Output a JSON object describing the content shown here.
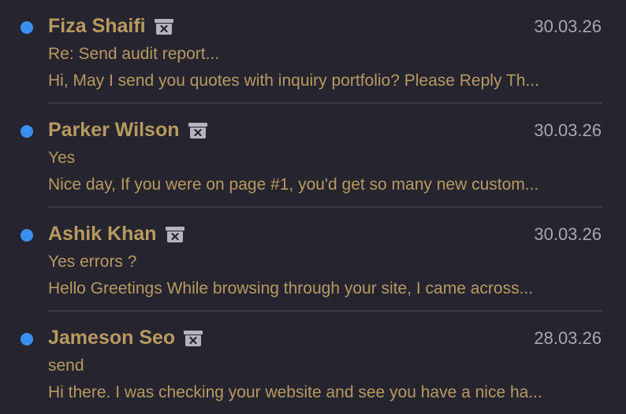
{
  "colors": {
    "background": "#25242f",
    "unread_dot": "#3b8ff2",
    "text_gold": "#b89a61",
    "date_gray": "#a8a6b1",
    "divider": "#3a3945"
  },
  "icons": {
    "unread": "unread-dot-icon",
    "archive": "archive-box-icon"
  },
  "messages": [
    {
      "sender": "Fiza Shaifi",
      "date": "30.03.26",
      "subject": "Re: Send audit report...",
      "preview": "Hi, May I send you quotes with inquiry portfolio? Please Reply Th..."
    },
    {
      "sender": "Parker Wilson",
      "date": "30.03.26",
      "subject": "Yes",
      "preview": "Nice day, If you were on page #1, you'd get so many new custom..."
    },
    {
      "sender": "Ashik Khan",
      "date": "30.03.26",
      "subject": "Yes errors ?",
      "preview": "Hello Greetings While browsing through your site, I came across..."
    },
    {
      "sender": "Jameson Seo",
      "date": "28.03.26",
      "subject": "send",
      "preview": "Hi there. I was checking your website and see you have a nice ha..."
    }
  ]
}
